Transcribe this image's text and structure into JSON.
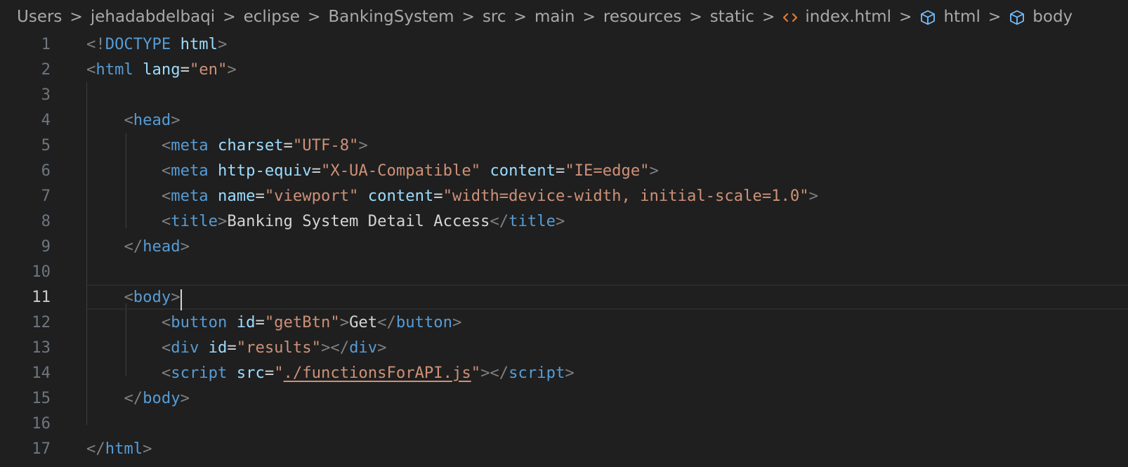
{
  "breadcrumb": {
    "segments": [
      "Users",
      "jehadabdelbaqi",
      "eclipse",
      "BankingSystem",
      "src",
      "main",
      "resources",
      "static"
    ],
    "file": "index.html",
    "symbols": [
      "html",
      "body"
    ]
  },
  "colors": {
    "background": "#1f1f1f",
    "tag": "#569cd6",
    "attribute": "#9cdcfe",
    "string": "#ce9178",
    "punctuation": "#808080",
    "text": "#d4d4d4",
    "html_file_icon": "#e37933",
    "symbol_icon": "#75beff"
  },
  "editor": {
    "current_line": 11,
    "lines": [
      {
        "n": "1",
        "tokens": [
          {
            "c": "p",
            "v": "<!"
          },
          {
            "c": "t",
            "v": "DOCTYPE"
          },
          {
            "c": "tx",
            "v": " "
          },
          {
            "c": "a",
            "v": "html"
          },
          {
            "c": "p",
            "v": ">"
          }
        ]
      },
      {
        "n": "2",
        "tokens": [
          {
            "c": "p",
            "v": "<"
          },
          {
            "c": "t",
            "v": "html"
          },
          {
            "c": "tx",
            "v": " "
          },
          {
            "c": "a",
            "v": "lang"
          },
          {
            "c": "tx",
            "v": "="
          },
          {
            "c": "s",
            "v": "\"en\""
          },
          {
            "c": "p",
            "v": ">"
          }
        ]
      },
      {
        "n": "3",
        "tokens": []
      },
      {
        "n": "4",
        "tokens": [
          {
            "c": "tx",
            "v": "    "
          },
          {
            "c": "p",
            "v": "<"
          },
          {
            "c": "t",
            "v": "head"
          },
          {
            "c": "p",
            "v": ">"
          }
        ]
      },
      {
        "n": "5",
        "tokens": [
          {
            "c": "tx",
            "v": "        "
          },
          {
            "c": "p",
            "v": "<"
          },
          {
            "c": "t",
            "v": "meta"
          },
          {
            "c": "tx",
            "v": " "
          },
          {
            "c": "a",
            "v": "charset"
          },
          {
            "c": "tx",
            "v": "="
          },
          {
            "c": "s",
            "v": "\"UTF-8\""
          },
          {
            "c": "p",
            "v": ">"
          }
        ]
      },
      {
        "n": "6",
        "tokens": [
          {
            "c": "tx",
            "v": "        "
          },
          {
            "c": "p",
            "v": "<"
          },
          {
            "c": "t",
            "v": "meta"
          },
          {
            "c": "tx",
            "v": " "
          },
          {
            "c": "a",
            "v": "http-equiv"
          },
          {
            "c": "tx",
            "v": "="
          },
          {
            "c": "s",
            "v": "\"X-UA-Compatible\""
          },
          {
            "c": "tx",
            "v": " "
          },
          {
            "c": "a",
            "v": "content"
          },
          {
            "c": "tx",
            "v": "="
          },
          {
            "c": "s",
            "v": "\"IE=edge\""
          },
          {
            "c": "p",
            "v": ">"
          }
        ]
      },
      {
        "n": "7",
        "tokens": [
          {
            "c": "tx",
            "v": "        "
          },
          {
            "c": "p",
            "v": "<"
          },
          {
            "c": "t",
            "v": "meta"
          },
          {
            "c": "tx",
            "v": " "
          },
          {
            "c": "a",
            "v": "name"
          },
          {
            "c": "tx",
            "v": "="
          },
          {
            "c": "s",
            "v": "\"viewport\""
          },
          {
            "c": "tx",
            "v": " "
          },
          {
            "c": "a",
            "v": "content"
          },
          {
            "c": "tx",
            "v": "="
          },
          {
            "c": "s",
            "v": "\"width=device-width, initial-scale=1.0\""
          },
          {
            "c": "p",
            "v": ">"
          }
        ]
      },
      {
        "n": "8",
        "tokens": [
          {
            "c": "tx",
            "v": "        "
          },
          {
            "c": "p",
            "v": "<"
          },
          {
            "c": "t",
            "v": "title"
          },
          {
            "c": "p",
            "v": ">"
          },
          {
            "c": "tx",
            "v": "Banking System Detail Access"
          },
          {
            "c": "p",
            "v": "</"
          },
          {
            "c": "t",
            "v": "title"
          },
          {
            "c": "p",
            "v": ">"
          }
        ]
      },
      {
        "n": "9",
        "tokens": [
          {
            "c": "tx",
            "v": "    "
          },
          {
            "c": "p",
            "v": "</"
          },
          {
            "c": "t",
            "v": "head"
          },
          {
            "c": "p",
            "v": ">"
          }
        ]
      },
      {
        "n": "10",
        "tokens": []
      },
      {
        "n": "11",
        "tokens": [
          {
            "c": "tx",
            "v": "    "
          },
          {
            "c": "p",
            "v": "<"
          },
          {
            "c": "t",
            "v": "body"
          },
          {
            "c": "p",
            "v": ">"
          }
        ]
      },
      {
        "n": "12",
        "tokens": [
          {
            "c": "tx",
            "v": "        "
          },
          {
            "c": "p",
            "v": "<"
          },
          {
            "c": "t",
            "v": "button"
          },
          {
            "c": "tx",
            "v": " "
          },
          {
            "c": "a",
            "v": "id"
          },
          {
            "c": "tx",
            "v": "="
          },
          {
            "c": "s",
            "v": "\"getBtn\""
          },
          {
            "c": "p",
            "v": ">"
          },
          {
            "c": "tx",
            "v": "Get"
          },
          {
            "c": "p",
            "v": "</"
          },
          {
            "c": "t",
            "v": "button"
          },
          {
            "c": "p",
            "v": ">"
          }
        ]
      },
      {
        "n": "13",
        "tokens": [
          {
            "c": "tx",
            "v": "        "
          },
          {
            "c": "p",
            "v": "<"
          },
          {
            "c": "t",
            "v": "div"
          },
          {
            "c": "tx",
            "v": " "
          },
          {
            "c": "a",
            "v": "id"
          },
          {
            "c": "tx",
            "v": "="
          },
          {
            "c": "s",
            "v": "\"results\""
          },
          {
            "c": "p",
            "v": "></"
          },
          {
            "c": "t",
            "v": "div"
          },
          {
            "c": "p",
            "v": ">"
          }
        ]
      },
      {
        "n": "14",
        "tokens": [
          {
            "c": "tx",
            "v": "        "
          },
          {
            "c": "p",
            "v": "<"
          },
          {
            "c": "t",
            "v": "script"
          },
          {
            "c": "tx",
            "v": " "
          },
          {
            "c": "a",
            "v": "src"
          },
          {
            "c": "tx",
            "v": "="
          },
          {
            "c": "s",
            "v": "\""
          },
          {
            "c": "s link",
            "v": "./functionsForAPI.js"
          },
          {
            "c": "s",
            "v": "\""
          },
          {
            "c": "p",
            "v": "></"
          },
          {
            "c": "t",
            "v": "script"
          },
          {
            "c": "p",
            "v": ">"
          }
        ]
      },
      {
        "n": "15",
        "tokens": [
          {
            "c": "tx",
            "v": "    "
          },
          {
            "c": "p",
            "v": "</"
          },
          {
            "c": "t",
            "v": "body"
          },
          {
            "c": "p",
            "v": ">"
          }
        ]
      },
      {
        "n": "16",
        "tokens": []
      },
      {
        "n": "17",
        "tokens": [
          {
            "c": "p",
            "v": "</"
          },
          {
            "c": "t",
            "v": "html"
          },
          {
            "c": "p",
            "v": ">"
          }
        ]
      }
    ]
  }
}
